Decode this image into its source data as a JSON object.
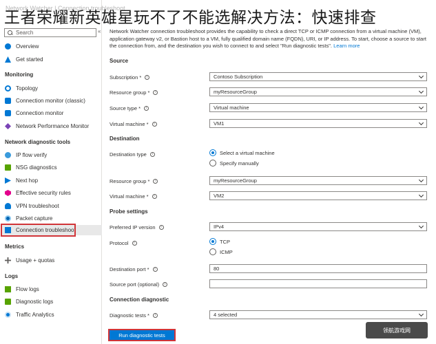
{
  "overlay_title": "王者荣耀新英雄星玩不了不能选解决方法：快速排查",
  "watermark": "Network Watcher | Connection troubleshoot",
  "page_heading": "N",
  "sidebar": {
    "search_placeholder": "Search",
    "collapse_label": "«",
    "items": [
      {
        "label": "Overview",
        "icon": "overview-icon"
      },
      {
        "label": "Get started",
        "icon": "get-started-icon"
      }
    ],
    "monitoring": {
      "title": "Monitoring",
      "items": [
        {
          "label": "Topology",
          "icon": "topology-icon"
        },
        {
          "label": "Connection monitor (classic)",
          "icon": "connection-monitor-classic-icon"
        },
        {
          "label": "Connection monitor",
          "icon": "connection-monitor-icon"
        },
        {
          "label": "Network Performance Monitor",
          "icon": "network-performance-monitor-icon"
        }
      ]
    },
    "diagnostics": {
      "title": "Network diagnostic tools",
      "items": [
        {
          "label": "IP flow verify",
          "icon": "ip-flow-verify-icon"
        },
        {
          "label": "NSG diagnostics",
          "icon": "nsg-diagnostics-icon"
        },
        {
          "label": "Next hop",
          "icon": "next-hop-icon"
        },
        {
          "label": "Effective security rules",
          "icon": "effective-security-rules-icon"
        },
        {
          "label": "VPN troubleshoot",
          "icon": "vpn-troubleshoot-icon"
        },
        {
          "label": "Packet capture",
          "icon": "packet-capture-icon"
        },
        {
          "label": "Connection troubleshoot",
          "icon": "connection-troubleshoot-icon"
        }
      ]
    },
    "metrics": {
      "title": "Metrics",
      "items": [
        {
          "label": "Usage + quotas",
          "icon": "usage-quotas-icon"
        }
      ]
    },
    "logs": {
      "title": "Logs",
      "items": [
        {
          "label": "Flow logs",
          "icon": "flow-logs-icon"
        },
        {
          "label": "Diagnostic logs",
          "icon": "diagnostic-logs-icon"
        },
        {
          "label": "Traffic Analytics",
          "icon": "traffic-analytics-icon"
        }
      ]
    }
  },
  "main": {
    "description": "Network Watcher connection troubleshoot provides the capability to check a direct TCP or ICMP connection from a virtual machine (VM), application gateway v2, or Bastion host to a VM, fully qualified domain name (FQDN), URI, or IP address. To start, choose a source to start the connection from, and the destination you wish to connect to and select \"Run diagnostic tests\".",
    "learn_more": "Learn more",
    "source": {
      "title": "Source",
      "subscription_label": "Subscription *",
      "subscription_value": "Contoso Subscription",
      "resource_group_label": "Resource group *",
      "resource_group_value": "myResourceGroup",
      "source_type_label": "Source type *",
      "source_type_value": "Virtual machine",
      "vm_label": "Virtual machine *",
      "vm_value": "VM1"
    },
    "destination": {
      "title": "Destination",
      "type_label": "Destination type",
      "option_select_vm": "Select a virtual machine",
      "option_manual": "Specify manually",
      "resource_group_label": "Resource group *",
      "resource_group_value": "myResourceGroup",
      "vm_label": "Virtual machine *",
      "vm_value": "VM2"
    },
    "probe": {
      "title": "Probe settings",
      "ip_version_label": "Preferred IP version",
      "ip_version_value": "IPv4",
      "protocol_label": "Protocol",
      "protocol_tcp": "TCP",
      "protocol_icmp": "ICMP",
      "dest_port_label": "Destination port *",
      "dest_port_value": "80",
      "source_port_label": "Source port (optional)",
      "source_port_value": ""
    },
    "conn_diag": {
      "title": "Connection diagnostic",
      "tests_label": "Diagnostic tests *",
      "tests_value": "4 selected"
    },
    "run_button": "Run diagnostic tests",
    "info_glyph": "i"
  },
  "stamp": "领航游戏网",
  "colors": {
    "accent": "#0078d4",
    "highlight": "#d13438"
  }
}
